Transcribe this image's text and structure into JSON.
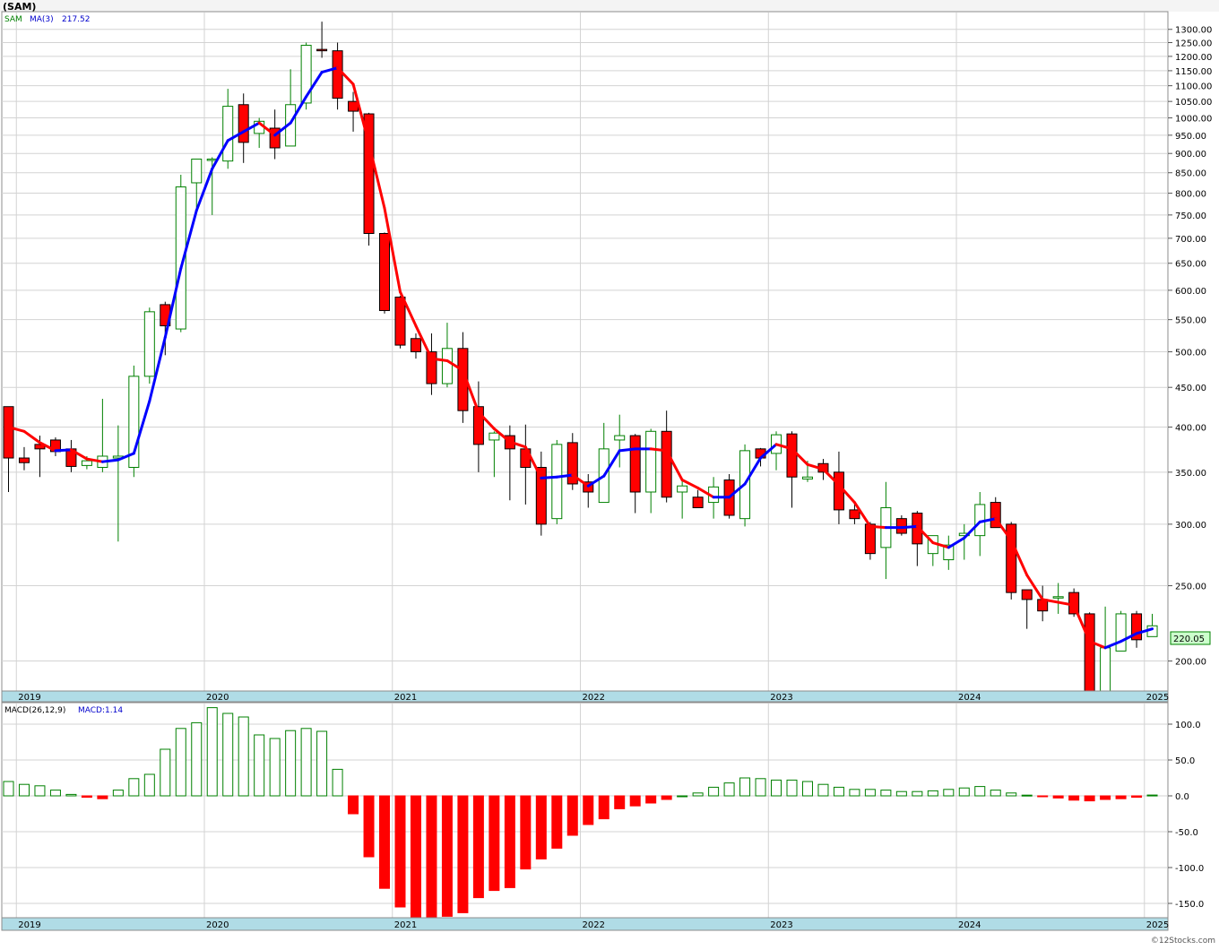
{
  "header": {
    "symbol": "(SAM)"
  },
  "price_panel": {
    "legend_symbol": "SAM",
    "ma_label": "MA(3)",
    "ma_value": "217.52",
    "last_price_label": "220.05",
    "y_ticks": [
      "1300.00",
      "1250.00",
      "1200.00",
      "1150.00",
      "1100.00",
      "1050.00",
      "1000.00",
      "950.00",
      "900.00",
      "850.00",
      "800.00",
      "750.00",
      "700.00",
      "650.00",
      "600.00",
      "550.00",
      "500.00",
      "450.00",
      "400.00",
      "350.00",
      "300.00",
      "250.00",
      "200.00"
    ],
    "x_axis_labels": [
      "2019",
      "2020",
      "2021",
      "2022",
      "2023",
      "2024",
      "2025"
    ]
  },
  "macd_panel": {
    "label": "MACD(26,12,9)",
    "value_label": "MACD:1.14",
    "y_ticks": [
      "100.0",
      "50.0",
      "0.0",
      "-50.0",
      "-100.0",
      "-150.0"
    ],
    "x_axis_labels": [
      "2019",
      "2020",
      "2021",
      "2022",
      "2023",
      "2024",
      "2025"
    ]
  },
  "watermark": "©12Stocks.com",
  "colors": {
    "up_candle": "#008000",
    "down_candle": "#ff0000",
    "ma_rising": "#0000ff",
    "ma_falling": "#ff0000",
    "grid": "#d3d3d3",
    "axis_band": "#b0dce6",
    "last_price_box": "#ccffcc"
  },
  "chart_data": [
    {
      "type": "candlestick",
      "title": "(SAM)",
      "period": "monthly",
      "scale": "log",
      "ylim": [
        183,
        1370
      ],
      "start_month": "2018-12",
      "x_labels": [
        "2019",
        "2020",
        "2021",
        "2022",
        "2023",
        "2024",
        "2025"
      ],
      "ohlc": [
        [
          425,
          425,
          330,
          365
        ],
        [
          365,
          377,
          352,
          360
        ],
        [
          380,
          390,
          345,
          375
        ],
        [
          385,
          388,
          367,
          372
        ],
        [
          375,
          385,
          350,
          356
        ],
        [
          357,
          367,
          353,
          362
        ],
        [
          355,
          435,
          350,
          367
        ],
        [
          365,
          402,
          285,
          367
        ],
        [
          355,
          480,
          345,
          465
        ],
        [
          465,
          570,
          455,
          563
        ],
        [
          575,
          580,
          495,
          540
        ],
        [
          535,
          845,
          530,
          815
        ],
        [
          825,
          885,
          755,
          885
        ],
        [
          885,
          890,
          750,
          885
        ],
        [
          880,
          1090,
          860,
          1035
        ],
        [
          1040,
          1075,
          875,
          930
        ],
        [
          955,
          1000,
          915,
          990
        ],
        [
          970,
          1025,
          885,
          915
        ],
        [
          920,
          1155,
          925,
          1040
        ],
        [
          1045,
          1250,
          1025,
          1240
        ],
        [
          1225,
          1330,
          1195,
          1220
        ],
        [
          1220,
          1250,
          1025,
          1060
        ],
        [
          1050,
          1080,
          960,
          1020
        ],
        [
          1012,
          1015,
          685,
          710
        ],
        [
          710,
          712,
          560,
          565
        ],
        [
          588,
          590,
          505,
          510
        ],
        [
          520,
          528,
          490,
          500
        ],
        [
          500,
          528,
          440,
          455
        ],
        [
          455,
          545,
          450,
          505
        ],
        [
          505,
          530,
          405,
          420
        ],
        [
          425,
          458,
          350,
          380
        ],
        [
          385,
          395,
          345,
          393
        ],
        [
          390,
          402,
          322,
          375
        ],
        [
          375,
          403,
          318,
          355
        ],
        [
          355,
          372,
          290,
          300
        ],
        [
          305,
          385,
          300,
          380
        ],
        [
          382,
          393,
          332,
          338
        ],
        [
          340,
          348,
          315,
          330
        ],
        [
          320,
          405,
          320,
          375
        ],
        [
          385,
          415,
          355,
          390
        ],
        [
          390,
          392,
          310,
          330
        ],
        [
          330,
          398,
          310,
          395
        ],
        [
          395,
          420,
          320,
          325
        ],
        [
          330,
          342,
          305,
          336
        ],
        [
          325,
          332,
          315,
          315
        ],
        [
          320,
          345,
          305,
          335
        ],
        [
          342,
          348,
          305,
          308
        ],
        [
          305,
          380,
          298,
          373
        ],
        [
          375,
          376,
          356,
          365
        ],
        [
          370,
          395,
          352,
          391
        ],
        [
          392,
          395,
          315,
          345
        ],
        [
          343,
          362,
          340,
          345
        ],
        [
          359,
          364,
          342,
          350
        ],
        [
          350,
          372,
          300,
          313
        ],
        [
          313,
          319,
          300,
          305
        ],
        [
          300,
          302,
          270,
          275
        ],
        [
          280,
          340,
          255,
          315
        ],
        [
          305,
          308,
          290,
          292
        ],
        [
          310,
          312,
          265,
          283
        ],
        [
          275,
          290,
          265,
          290
        ],
        [
          270,
          290,
          262,
          282
        ],
        [
          290,
          300,
          270,
          292
        ],
        [
          290,
          330,
          273,
          318
        ],
        [
          320,
          325,
          297,
          297
        ],
        [
          300,
          302,
          240,
          245
        ],
        [
          247,
          247,
          220,
          240
        ],
        [
          240,
          250,
          225,
          232
        ],
        [
          242,
          252,
          230,
          242
        ],
        [
          245,
          248,
          228,
          230
        ],
        [
          230,
          231,
          180,
          180
        ],
        [
          182,
          235,
          180,
          208
        ],
        [
          206,
          232,
          208,
          230
        ],
        [
          230,
          232,
          208,
          213
        ],
        [
          215,
          230,
          215,
          222
        ]
      ],
      "ma3": [
        400,
        395,
        382,
        373,
        374,
        364,
        361,
        363,
        370,
        432,
        522,
        640,
        760,
        860,
        935,
        960,
        985,
        950,
        985,
        1065,
        1145,
        1160,
        1105,
        927,
        765,
        597,
        540,
        490,
        487,
        473,
        418,
        398,
        383,
        377,
        344,
        345,
        347,
        336,
        346,
        373,
        375,
        375,
        373,
        342,
        334,
        325,
        325,
        338,
        365,
        380,
        375,
        358,
        353,
        337,
        320,
        298,
        297,
        297,
        298,
        284,
        280,
        288,
        302,
        305,
        286,
        258,
        240,
        238,
        236,
        212,
        208,
        212,
        217,
        220
      ]
    },
    {
      "type": "bar",
      "title": "MACD(26,12,9)",
      "ylim": [
        -170,
        130
      ],
      "values": [
        20,
        16,
        14,
        8,
        2,
        -2,
        -4,
        8,
        24,
        30,
        65,
        94,
        102,
        123,
        115,
        110,
        85,
        80,
        91,
        94,
        90,
        37,
        -25,
        -85,
        -129,
        -155,
        -170,
        -170,
        -168,
        -163,
        -142,
        -132,
        -128,
        -102,
        -88,
        -73,
        -55,
        -40,
        -32,
        -18,
        -14,
        -10,
        -5,
        0,
        4,
        12,
        18,
        25,
        24,
        22,
        22,
        20,
        16,
        12,
        9,
        9,
        8,
        6,
        6,
        7,
        9,
        11,
        13,
        8,
        4,
        1,
        -1,
        -3,
        -6,
        -7,
        -5,
        -4,
        -2,
        1.14
      ]
    }
  ]
}
